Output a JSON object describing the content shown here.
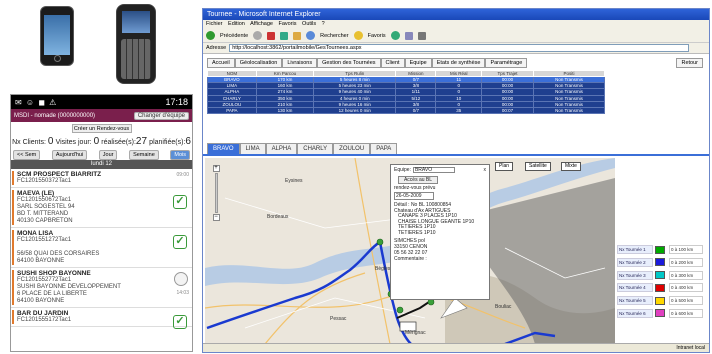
{
  "android": {
    "status_time": "17:18",
    "header_title": "MSDI - nomade (0000000000)",
    "change_team_label": "Changer d'équipe",
    "create_rdv_label": "Créer un Rendez-vous",
    "nb_clients_label": "Nx Clients:",
    "nb_clients_value": "0",
    "visites_label": "Visites jour:",
    "visites_value": "0",
    "realisees_label": "réalisée(s):",
    "realisees_value": "27",
    "planifiees_label": "planifiée(s):",
    "planifiees_value": "6",
    "nav": {
      "prev": "<< Sem",
      "today": "Aujourd'hui",
      "jour": "Jour",
      "semaine": "Semaine",
      "mois": "Mois"
    },
    "day_label": "lundi 12",
    "items": [
      {
        "title": "SCM PROSPECT BIARRITZ",
        "lines": [
          "FC1201550372Tac1"
        ],
        "time": "09:00",
        "status": "none"
      },
      {
        "title": "MAEVA (LE)",
        "lines": [
          "FC1201550672Tac1",
          "SARL SOGESTEL 94",
          "BD T. MITTERAND",
          "40130 CAPBRETON"
        ],
        "time": "",
        "status": "done"
      },
      {
        "title": "MONA LISA",
        "lines": [
          "FC1201551272Tac1",
          "",
          "56/58 QUAI DES CORSAIRES",
          "64100 BAYONNE"
        ],
        "time": "",
        "status": "done"
      },
      {
        "title": "SUSHI SHOP BAYONNE",
        "lines": [
          "FC1201552772Tac1",
          "SUSHI BAYONNE DEVELOPPEMENT",
          "6 PLACE DE LA LIBERTE",
          "64100 BAYONNE"
        ],
        "time": "14:03",
        "status": "clock"
      },
      {
        "title": "BAR DU JARDIN",
        "lines": [
          "FC1201555172Tac1"
        ],
        "time": "",
        "status": "done"
      }
    ]
  },
  "ie": {
    "title": "Tournee - Microsoft Internet Explorer",
    "menu": [
      "Fichier",
      "Edition",
      "Affichage",
      "Favoris",
      "Outils",
      "?"
    ],
    "toolbar": {
      "back": "Précédente",
      "search": "Rechercher",
      "favorites": "Favoris"
    },
    "address_label": "Adresse",
    "address_value": "http://localhost:3862/portailmobile/GesTournees.aspx",
    "status_text": "Intranet local"
  },
  "app": {
    "menu": [
      "Accueil",
      "Géolocalisation",
      "Livraisons",
      "Gestion des Tournées",
      "Client",
      "Equipe",
      "Etats de synthèse",
      "Paramétrage"
    ],
    "back_label": "Retour",
    "grid_headers": [
      "NOM",
      "Km Parcou",
      "Tps Rulin",
      "Mission",
      "Mis Réal",
      "Tps Trajet",
      "Positi"
    ],
    "grid_rows": [
      [
        "BRAVO",
        "170 km",
        "5 heures 8 min",
        "0/7",
        "11",
        "00:00",
        "Non Transmis"
      ],
      [
        "LIMA",
        "160 km",
        "5 heures 23 min",
        "3/8",
        "0",
        "00:00",
        "Non Transmis"
      ],
      [
        "ALPHA",
        "274 km",
        "9 heures 40 min",
        "1/11",
        "0",
        "00:00",
        "Non Transmis"
      ],
      [
        "CHARLY",
        "350 km",
        "4 heures 0 min",
        "5/12",
        "10",
        "00:00",
        "Non Transmis"
      ],
      [
        "ZOULOU",
        "210 km",
        "9 heures 16 min",
        "3/8",
        "0",
        "00:00",
        "Non Transmis"
      ],
      [
        "PAPA",
        "130 km",
        "12 heures 0 min",
        "0/7",
        "35",
        "00:07",
        "Non Transmis"
      ]
    ],
    "selected_row": 0,
    "tabs": [
      "BRAVO",
      "LIMA",
      "ALPHA",
      "CHARLY",
      "ZOULOU",
      "PAPA"
    ],
    "active_tab": 0,
    "map_types": [
      "Plan",
      "Satellite",
      "Mixte"
    ],
    "popup": {
      "equipe_label": "Equipe:",
      "equipe_value": "BRAVO",
      "bl_button": "Accès au BL",
      "rdv_label": "rendez-vous prévu",
      "rdv_date": "26-05-2009",
      "detail_line1": "Détail : No BL 100800854",
      "detail_line2": "Chateau d'Ax ARTIGUES",
      "products": [
        "CANAPE 3 PLACES 1P10",
        "CHAISE LONGUE GEANTE 1P10",
        "TETIERES 1P10",
        "TETIERES 1P10"
      ],
      "client_name": "SIMCHES pol",
      "client_city": "33150 CENON",
      "client_phone": "05 56 32 22 07",
      "comment_label": "Commentaire :",
      "close": "x"
    },
    "legend": [
      {
        "name": "Nx Tournée 1",
        "color": "#00aa00",
        "km": "0 à 100 km"
      },
      {
        "name": "Nx Tournée 2",
        "color": "#1a1adc",
        "km": "0 à 200 km"
      },
      {
        "name": "Nx Tournée 3",
        "color": "#00c8c8",
        "km": "0 à 300 km"
      },
      {
        "name": "Nx Tournée 4",
        "color": "#e00000",
        "km": "0 à 400 km"
      },
      {
        "name": "Nx Tournée 5",
        "color": "#ffd800",
        "km": "0 à 500 km"
      },
      {
        "name": "Nx Tournée 6",
        "color": "#e040c0",
        "km": "0 à 600 km"
      }
    ]
  }
}
